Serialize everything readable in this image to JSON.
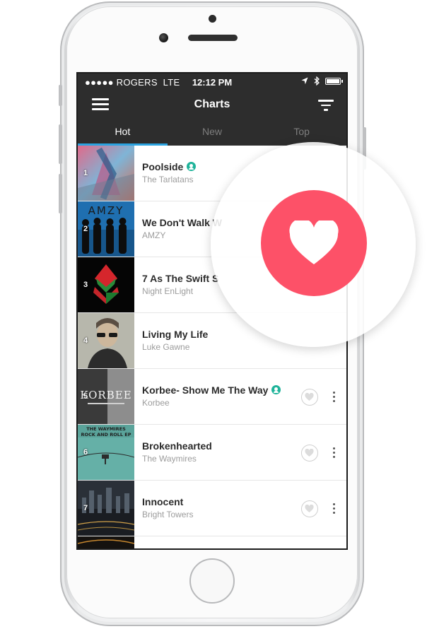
{
  "status_bar": {
    "signal": "●●●●● ROGERS",
    "network": "LTE",
    "time": "12:12 PM"
  },
  "nav": {
    "title": "Charts"
  },
  "tabs": [
    {
      "label": "Hot",
      "active": true
    },
    {
      "label": "New",
      "active": false
    },
    {
      "label": "Top",
      "active": false
    }
  ],
  "tracks": [
    {
      "rank": "1",
      "title": "Poolside",
      "artist": "The Tarlatans",
      "verified": true
    },
    {
      "rank": "2",
      "title": "We Don't Walk W",
      "artist": "AMZY",
      "verified": false,
      "art_text": "AMZY"
    },
    {
      "rank": "3",
      "title": "7 As The Swift S",
      "artist": "Night EnLight",
      "verified": false
    },
    {
      "rank": "4",
      "title": "Living My Life",
      "artist": "Luke Gawne",
      "verified": false
    },
    {
      "rank": "5",
      "title": "Korbee- Show Me The Way",
      "artist": "Korbee",
      "verified": true,
      "art_text": "KORBEE"
    },
    {
      "rank": "6",
      "title": "Brokenhearted",
      "artist": "The Waymires",
      "verified": false,
      "art_text": "THE WAYMIRES ROCK AND ROLL EP"
    },
    {
      "rank": "7",
      "title": "Innocent",
      "artist": "Bright Towers",
      "verified": false
    }
  ],
  "colors": {
    "bar": "#2d2d2d",
    "tab_indicator": "#2ba3e0",
    "heart_accent": "#fd5168",
    "verified": "#1fb39a"
  },
  "icons": {
    "menu": "hamburger-icon",
    "filter": "filter-icon",
    "like": "heart-outline-icon",
    "more": "vertical-dots-icon",
    "featured_like": "heart-filled-icon"
  }
}
